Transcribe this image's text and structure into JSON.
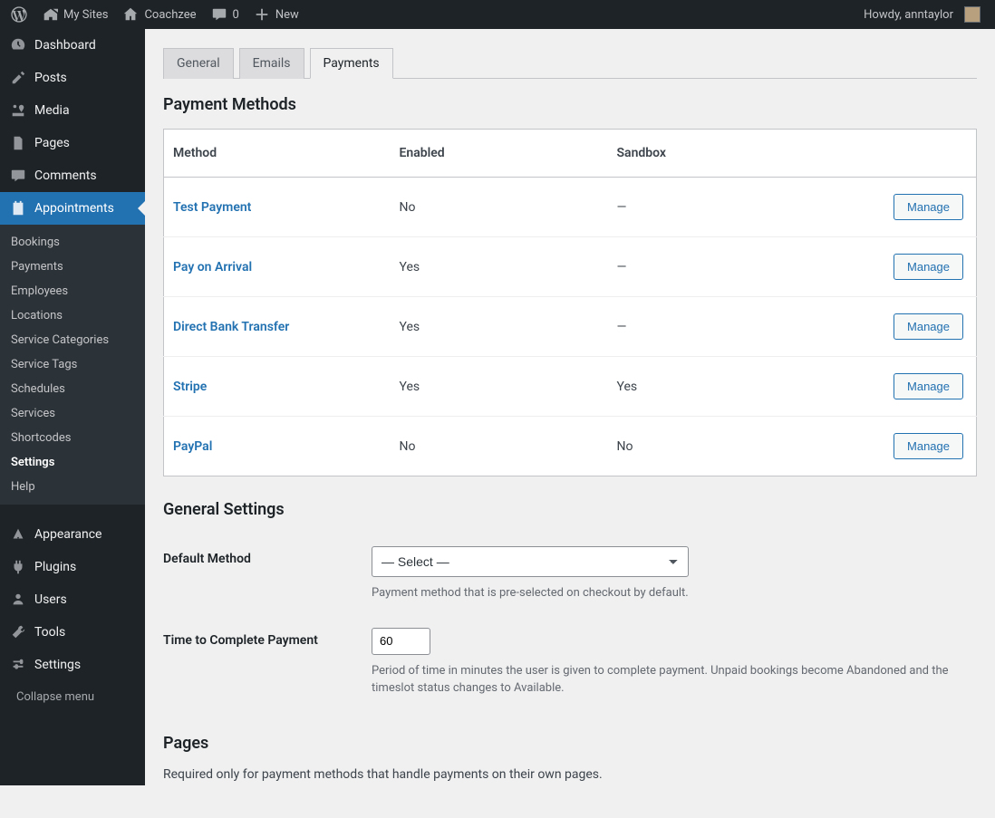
{
  "adminbar": {
    "mysites": "My Sites",
    "sitename": "Coachzee",
    "comments": "0",
    "new": "New",
    "greeting": "Howdy, anntaylor"
  },
  "sidebar": {
    "primary": [
      {
        "id": "dashboard",
        "label": "Dashboard"
      },
      {
        "id": "posts",
        "label": "Posts"
      },
      {
        "id": "media",
        "label": "Media"
      },
      {
        "id": "pages",
        "label": "Pages"
      },
      {
        "id": "comments",
        "label": "Comments"
      },
      {
        "id": "appointments",
        "label": "Appointments",
        "current": true
      }
    ],
    "appointments_sub": [
      {
        "label": "Bookings"
      },
      {
        "label": "Payments"
      },
      {
        "label": "Employees"
      },
      {
        "label": "Locations"
      },
      {
        "label": "Service Categories"
      },
      {
        "label": "Service Tags"
      },
      {
        "label": "Schedules"
      },
      {
        "label": "Services"
      },
      {
        "label": "Shortcodes"
      },
      {
        "label": "Settings",
        "active": true
      },
      {
        "label": "Help"
      }
    ],
    "secondary": [
      {
        "id": "appearance",
        "label": "Appearance"
      },
      {
        "id": "plugins",
        "label": "Plugins"
      },
      {
        "id": "users",
        "label": "Users"
      },
      {
        "id": "tools",
        "label": "Tools"
      },
      {
        "id": "settings",
        "label": "Settings"
      }
    ],
    "collapse": "Collapse menu"
  },
  "tabs": [
    {
      "label": "General"
    },
    {
      "label": "Emails"
    },
    {
      "label": "Payments",
      "active": true
    }
  ],
  "payment_methods": {
    "heading": "Payment Methods",
    "columns": {
      "method": "Method",
      "enabled": "Enabled",
      "sandbox": "Sandbox"
    },
    "rows": [
      {
        "method": "Test Payment",
        "enabled": "No",
        "sandbox": "—"
      },
      {
        "method": "Pay on Arrival",
        "enabled": "Yes",
        "sandbox": "—"
      },
      {
        "method": "Direct Bank Transfer",
        "enabled": "Yes",
        "sandbox": "—"
      },
      {
        "method": "Stripe",
        "enabled": "Yes",
        "sandbox": "Yes"
      },
      {
        "method": "PayPal",
        "enabled": "No",
        "sandbox": "No"
      }
    ],
    "manage": "Manage"
  },
  "general_settings": {
    "heading": "General Settings",
    "default_method": {
      "label": "Default Method",
      "value": "— Select —",
      "desc": "Payment method that is pre-selected on checkout by default."
    },
    "time_to_complete": {
      "label": "Time to Complete Payment",
      "value": "60",
      "desc": "Period of time in minutes the user is given to complete payment. Unpaid bookings become Abandoned and the timeslot status changes to Available."
    }
  },
  "pages": {
    "heading": "Pages",
    "desc": "Required only for payment methods that handle payments on their own pages."
  }
}
